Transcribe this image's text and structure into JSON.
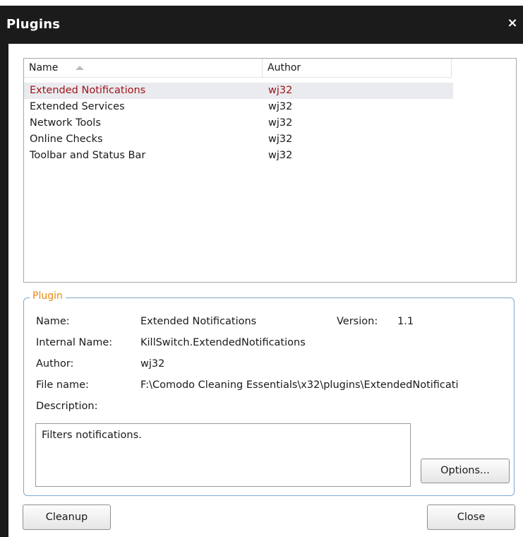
{
  "window": {
    "title": "Plugins",
    "close_glyph": "×"
  },
  "list": {
    "columns": [
      "Name",
      "Author"
    ],
    "rows": [
      {
        "name": "Extended Notifications",
        "author": "wj32",
        "selected": true
      },
      {
        "name": "Extended Services",
        "author": "wj32"
      },
      {
        "name": "Network Tools",
        "author": "wj32"
      },
      {
        "name": "Online Checks",
        "author": "wj32"
      },
      {
        "name": "Toolbar and Status Bar",
        "author": "wj32"
      }
    ]
  },
  "plugin": {
    "legend": "Plugin",
    "name_label": "Name:",
    "name_value": "Extended Notifications",
    "version_label": "Version:",
    "version_value": "1.1",
    "internal_label": "Internal Name:",
    "internal_value": "KillSwitch.ExtendedNotifications",
    "author_label": "Author:",
    "author_value": "wj32",
    "file_label": "File name:",
    "file_value": "F:\\Comodo Cleaning Essentials\\x32\\plugins\\ExtendedNotificati",
    "description_label": "Description:",
    "description_value": "Filters notifications.",
    "options_button": "Options..."
  },
  "buttons": {
    "cleanup": "Cleanup",
    "close": "Close"
  },
  "colors": {
    "titlebar": "#1b1b1b",
    "selected_text": "#a0141a",
    "legend": "#e88a10",
    "group_border": "#7ea8cf"
  },
  "icons": {
    "close": "close-icon",
    "sort": "sort-ascending-icon"
  }
}
